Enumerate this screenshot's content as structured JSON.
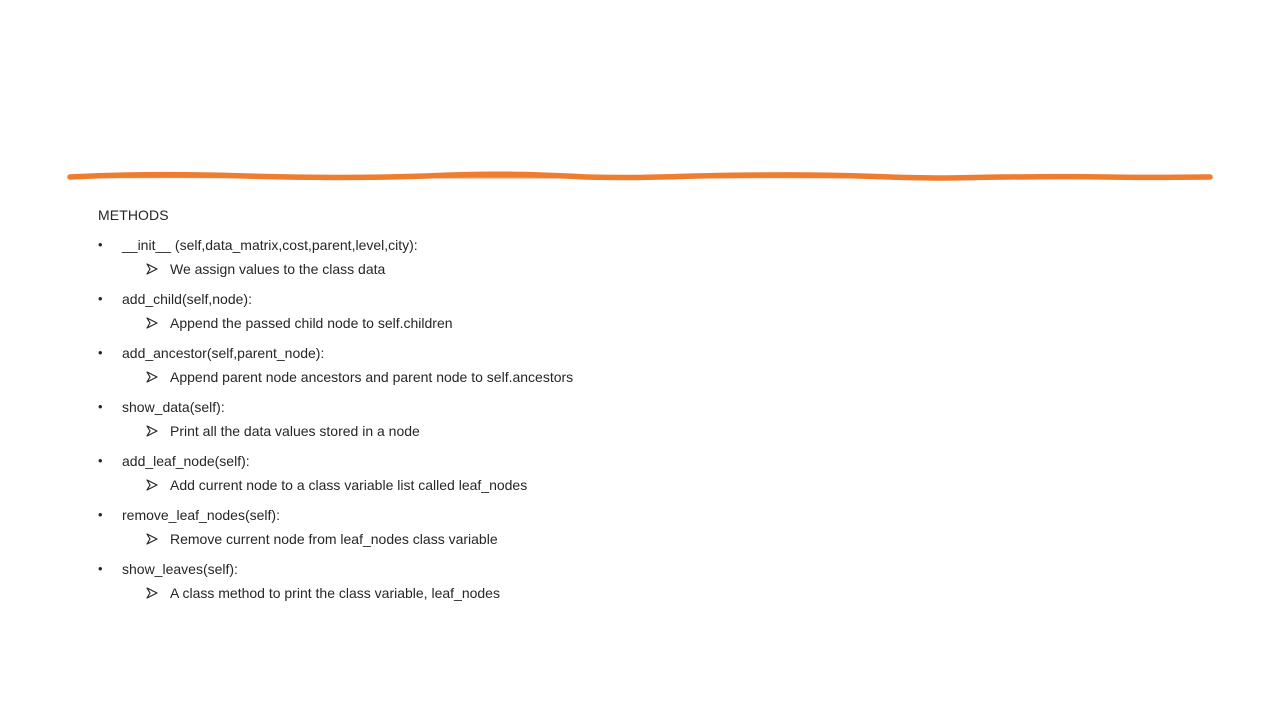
{
  "colors": {
    "accent": "#ED7D31",
    "text": "#262626",
    "background": "#FFFFFF"
  },
  "icons": {
    "bullet": "bullet-dot-icon",
    "sub_bullet": "arrowhead-bullet-icon"
  },
  "slide": {
    "heading": "METHODS",
    "methods": [
      {
        "signature": "__init__ (self,data_matrix,cost,parent,level,city):",
        "description": "We assign values to the class data"
      },
      {
        "signature": "add_child(self,node):",
        "description": "Append the passed child node to self.children"
      },
      {
        "signature": "add_ancestor(self,parent_node):",
        "description": "Append parent node ancestors and parent node to self.ancestors"
      },
      {
        "signature": "show_data(self):",
        "description": "Print all the data values stored in a node"
      },
      {
        "signature": "add_leaf_node(self):",
        "description": "Add current node to a class variable list called leaf_nodes"
      },
      {
        "signature": "remove_leaf_nodes(self):",
        "description": "Remove current node from leaf_nodes class variable"
      },
      {
        "signature": "show_leaves(self):",
        "description": "A class method to print the class variable, leaf_nodes"
      }
    ]
  }
}
